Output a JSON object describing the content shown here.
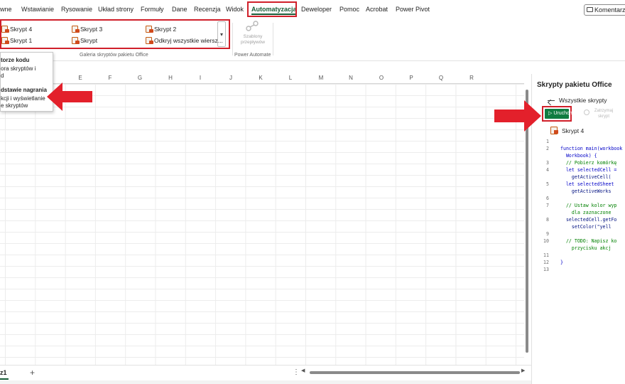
{
  "tabs": [
    {
      "label": "wne"
    },
    {
      "label": "Wstawianie"
    },
    {
      "label": "Rysowanie"
    },
    {
      "label": "Układ strony"
    },
    {
      "label": "Formuły"
    },
    {
      "label": "Dane"
    },
    {
      "label": "Recenzja"
    },
    {
      "label": "Widok"
    },
    {
      "label": "Automatyzacja"
    },
    {
      "label": "Deweloper"
    },
    {
      "label": "Pomoc"
    },
    {
      "label": "Acrobat"
    },
    {
      "label": "Power Pivot"
    }
  ],
  "comments_button": "Komentarze",
  "ribbon": {
    "scripts": [
      "Skrypt 4",
      "Skrypt 3",
      "Skrypt 2",
      "Skrypt 1",
      "Skrypt",
      "Odkryj wszystkie wiersz..."
    ],
    "gallery_label": "Galeria skryptów pakietu Office",
    "pa_label": "Szablony przepływów",
    "pa_group_label": "Power Automate"
  },
  "menu": {
    "item1_title": "torze kodu",
    "item1_desc1": "ora skryptów i",
    "item1_desc2": "d",
    "item2_title": "dstawie nagrania",
    "item2_desc1": "kcji i wyświetlanie",
    "item2_desc2": "e skryptów"
  },
  "columns": [
    "E",
    "F",
    "G",
    "H",
    "I",
    "J",
    "K",
    "L",
    "M",
    "N",
    "O",
    "P",
    "Q",
    "R"
  ],
  "sheet": {
    "tab_label": "z1",
    "add": "+",
    "dots": "⋮"
  },
  "pane": {
    "title": "Skrypty pakietu Office",
    "back_label": "Wszystkie skrypty",
    "run_label": "Uruchom",
    "stop_label": "Zatrzymaj skrypt",
    "script_name": "Skrypt 4",
    "code": [
      {
        "n": "1",
        "t": "",
        "k": "plain"
      },
      {
        "n": "2",
        "t": "function main(workbook",
        "k": "kw"
      },
      {
        "n": "",
        "t": "  Workbook) {",
        "k": "kw"
      },
      {
        "n": "3",
        "t": "  // Pobierz komórkę",
        "k": "comment"
      },
      {
        "n": "4",
        "t": "  let selectedCell =",
        "k": "kw"
      },
      {
        "n": "",
        "t": "    getActiveCell(",
        "k": "plain"
      },
      {
        "n": "5",
        "t": "  let selectedSheet",
        "k": "kw"
      },
      {
        "n": "",
        "t": "    getActiveWorks",
        "k": "plain"
      },
      {
        "n": "6",
        "t": "",
        "k": "plain"
      },
      {
        "n": "7",
        "t": "  // Ustaw kolor wyp",
        "k": "comment"
      },
      {
        "n": "",
        "t": "    dla zaznaczone",
        "k": "comment"
      },
      {
        "n": "8",
        "t": "  selectedCell.getFo",
        "k": "plain"
      },
      {
        "n": "",
        "t": "    setColor(\"yell",
        "k": "plain"
      },
      {
        "n": "9",
        "t": "",
        "k": "plain"
      },
      {
        "n": "10",
        "t": "  // TODO: Napisz ko",
        "k": "comment"
      },
      {
        "n": "",
        "t": "    przycisku akcj",
        "k": "comment"
      },
      {
        "n": "11",
        "t": "",
        "k": "plain"
      },
      {
        "n": "12",
        "t": "}",
        "k": "kw"
      },
      {
        "n": "13",
        "t": "",
        "k": "plain"
      }
    ]
  },
  "colors": {
    "accent": "#185c37",
    "run_green": "#107c41",
    "highlight_red": "#d0202a"
  }
}
